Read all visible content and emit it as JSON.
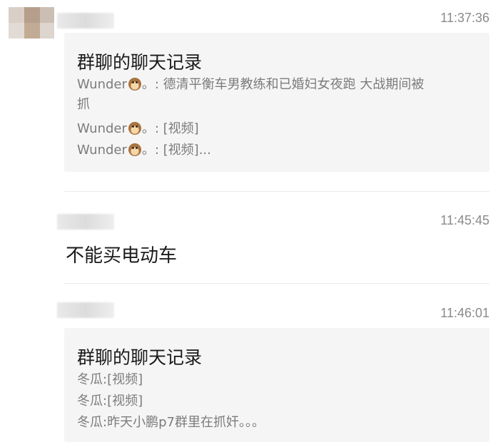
{
  "messages": [
    {
      "time": "11:37:36",
      "card": {
        "title": "群聊的聊天记录",
        "lines": [
          {
            "name": "Wunder",
            "suffix": "。: 德清平衡车男教练和已婚妇女夜跑 大战期间被"
          },
          {
            "text": "抓"
          },
          {
            "name": "Wunder",
            "suffix": "。: [视频]"
          },
          {
            "name": "Wunder",
            "suffix": "。: [视频]..."
          }
        ]
      }
    },
    {
      "time": "11:45:45",
      "text": "不能买电动车"
    },
    {
      "time": "11:46:01",
      "card": {
        "title": "群聊的聊天记录",
        "lines": [
          {
            "text": "冬瓜:[视频]"
          },
          {
            "text": "冬瓜:[视频]"
          },
          {
            "text": "冬瓜:昨天小鹏p7群里在抓奸。。。"
          }
        ]
      }
    }
  ],
  "icons": {
    "emoji": "monkey-icon"
  }
}
